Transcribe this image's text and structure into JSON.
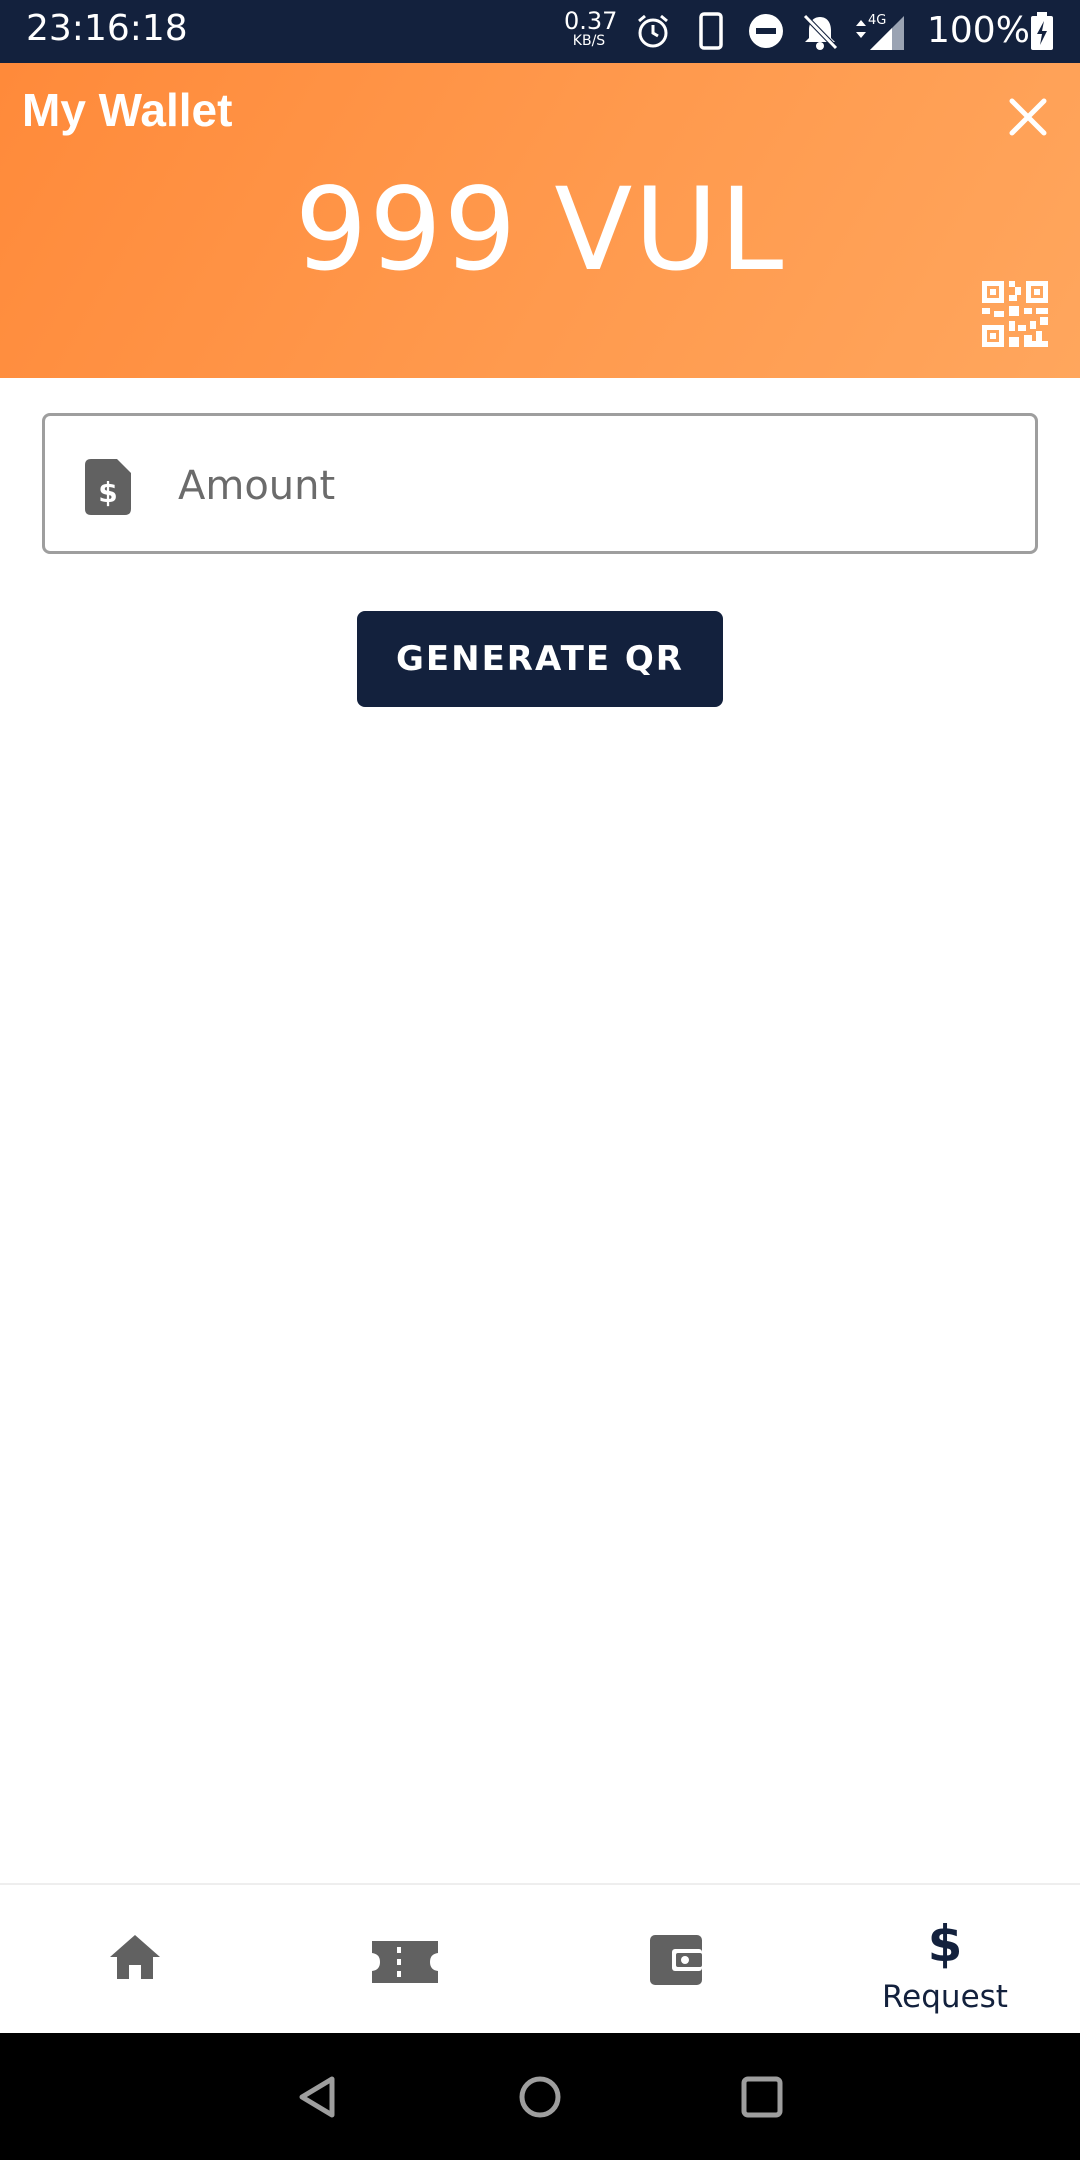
{
  "status_bar": {
    "time": "23:16:18",
    "net_speed_value": "0.37",
    "net_speed_unit": "KB/S",
    "network_type": "4G",
    "battery": "100%",
    "icons": [
      "alarm-icon",
      "phone-icon",
      "do-not-disturb-icon",
      "bell-off-icon",
      "signal-icon",
      "battery-charging-icon"
    ]
  },
  "header": {
    "title": "My Wallet",
    "balance_amount": "999",
    "balance_currency": "VUL",
    "close_icon": "close-icon",
    "qr_icon": "qr-code-icon"
  },
  "amount_field": {
    "placeholder": "Amount",
    "value": "",
    "icon": "money-document-icon"
  },
  "generate_button": {
    "label": "GENERATE QR"
  },
  "bottom_nav": {
    "items": [
      {
        "id": "home",
        "icon": "home-icon",
        "label": ""
      },
      {
        "id": "tickets",
        "icon": "ticket-icon",
        "label": ""
      },
      {
        "id": "wallet",
        "icon": "wallet-icon",
        "label": ""
      },
      {
        "id": "request",
        "icon": "dollar-icon",
        "label": "Request",
        "active": true
      }
    ]
  },
  "system_nav": {
    "buttons": [
      "back-icon",
      "home-circle-icon",
      "recents-icon"
    ]
  },
  "colors": {
    "status_bar": "#13213d",
    "header_gradient_start": "#ff8a3a",
    "header_gradient_end": "#ffa65d",
    "primary_dark": "#13213d",
    "icon_gray": "#616161"
  }
}
